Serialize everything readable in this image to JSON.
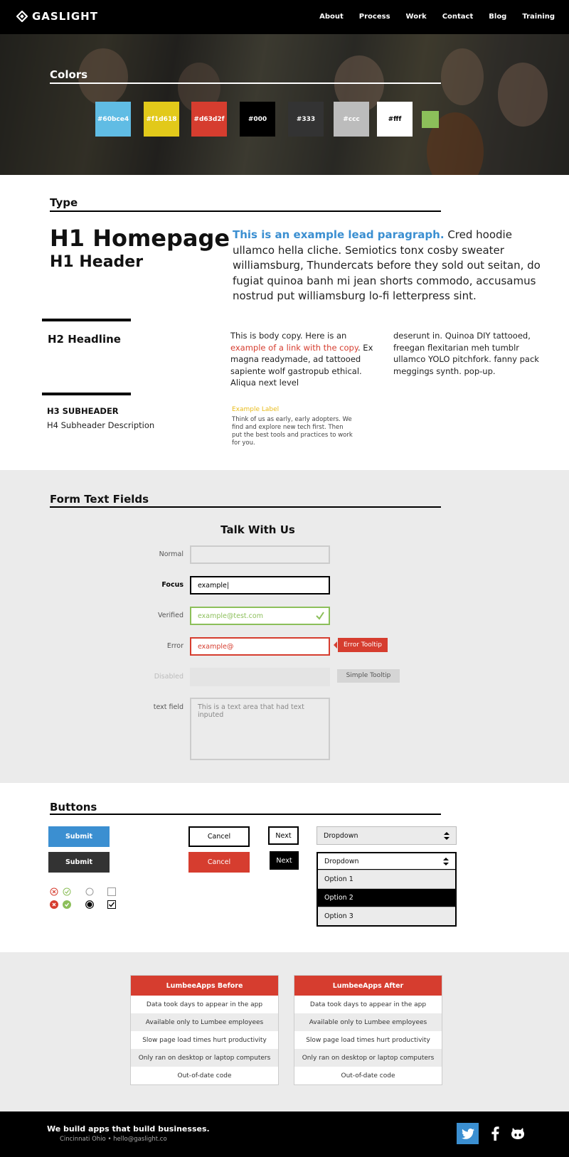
{
  "nav": {
    "logo": "GASLIGHT",
    "links": [
      "About",
      "Process",
      "Work",
      "Contact",
      "Blog",
      "Training"
    ]
  },
  "colors": {
    "title": "Colors",
    "swatches": [
      {
        "label": "#60bce4",
        "color": "#60bce4"
      },
      {
        "label": "#f1d618",
        "color": "#e2c91a"
      },
      {
        "label": "#d63d2f",
        "color": "#d63d2f"
      },
      {
        "label": "#000",
        "color": "#000000"
      },
      {
        "label": "#333",
        "color": "#333333"
      },
      {
        "label": "#ccc",
        "color": "#bcbcbc"
      },
      {
        "label": "#fff",
        "color": "#ffffff"
      },
      {
        "label": "",
        "color": "#8cbf5a"
      }
    ]
  },
  "type": {
    "title": "Type",
    "h1_homepage": "H1 Homepage",
    "h1_header": "H1 Header",
    "lead_highlight": "This is an example lead paragraph.",
    "lead_rest": " Cred hoodie ullamco hella cliche. Semiotics tonx cosby sweater williamsburg, Thundercats before they sold out seitan, do fugiat quinoa banh mi jean shorts commodo, accusamus nostrud put williamsburg lo-fi letterpress sint.",
    "h2": "H2 Headline",
    "body_a": "This is body copy. Here is an ",
    "body_link": "example of a link with the copy",
    "body_b": ". Ex magna readymade, ad tattooed sapiente wolf gastropub ethical. Aliqua next level",
    "body_col2": "deserunt in. Quinoa DIY tattooed, freegan flexitarian meh tumblr ullamco YOLO pitchfork. fanny pack meggings synth. pop-up.",
    "h3": "H3 SUBHEADER",
    "h4": "H4 Subheader Description",
    "example_label": "Example Label",
    "example_text": "Think of us as early, early adopters. We find and explore new tech first. Then put the best tools and practices to work for you."
  },
  "form": {
    "title": "Form Text Fields",
    "heading": "Talk With Us",
    "labels": {
      "normal": "Normal",
      "focus": "Focus",
      "verified": "Verified",
      "error": "Error",
      "disabled": "Disabled",
      "textfield": "text field"
    },
    "values": {
      "focus": "example|",
      "verified": "example@test.com",
      "error": "example@",
      "textarea": "This is a text area that had text inputed"
    },
    "error_tooltip": "Error Tooltip",
    "simple_tooltip": "Simple Tooltip"
  },
  "buttons": {
    "title": "Buttons",
    "submit": "Submit",
    "cancel": "Cancel",
    "next": "Next",
    "dropdown": "Dropdown",
    "options": [
      "Option 1",
      "Option 2",
      "Option 3"
    ],
    "selected_option": "Option 2"
  },
  "tables": {
    "before": {
      "title": "LumbeeApps Before",
      "rows": [
        "Data took days to appear in the app",
        "Available only to Lumbee employees",
        "Slow page load times hurt productivity",
        "Only ran on desktop or laptop computers",
        "Out-of-date code"
      ]
    },
    "after": {
      "title": "LumbeeApps After",
      "rows": [
        "Data took days to appear in the app",
        "Available only to Lumbee employees",
        "Slow page load times hurt productivity",
        "Only ran on desktop or laptop computers",
        "Out-of-date code"
      ]
    }
  },
  "footer": {
    "tagline": "We build apps that build businesses.",
    "contact": "Cincinnati Ohio • hello@gaslight.co",
    "social_icons": [
      "twitter-icon",
      "facebook-icon",
      "github-icon"
    ]
  },
  "palette": {
    "blue": "#3b8fd1",
    "red": "#d63d2f",
    "green": "#8cbf5a",
    "yellow": "#e8bb1a"
  }
}
